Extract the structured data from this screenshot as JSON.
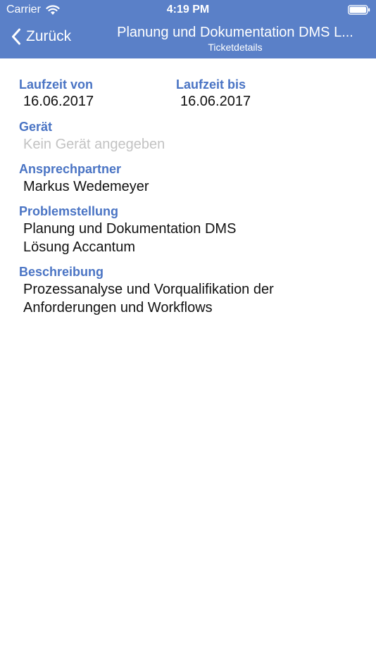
{
  "status_bar": {
    "carrier": "Carrier",
    "time": "4:19 PM"
  },
  "nav": {
    "back_label": "Zurück",
    "title": "Planung und Dokumentation DMS L...",
    "subtitle": "Ticketdetails"
  },
  "fields": {
    "laufzeit_von_label": "Laufzeit von",
    "laufzeit_von_value": "16.06.2017",
    "laufzeit_bis_label": "Laufzeit bis",
    "laufzeit_bis_value": "16.06.2017",
    "geraet_label": "Gerät",
    "geraet_value": "Kein Gerät angegeben",
    "ansprechpartner_label": "Ansprechpartner",
    "ansprechpartner_value": "Markus Wedemeyer",
    "problemstellung_label": "Problemstellung",
    "problemstellung_line1": "Planung und Dokumentation DMS",
    "problemstellung_line2": "Lösung Accantum",
    "beschreibung_label": "Beschreibung",
    "beschreibung_line1": "Prozessanalyse und Vorqualifikation der",
    "beschreibung_line2": "Anforderungen und Workflows"
  },
  "colors": {
    "header_bg": "#5a80c8",
    "label": "#4a74c4",
    "placeholder": "#c3c3c3"
  },
  "icons": {
    "wifi": "wifi-icon",
    "battery": "battery-icon",
    "back": "chevron-left-icon"
  }
}
